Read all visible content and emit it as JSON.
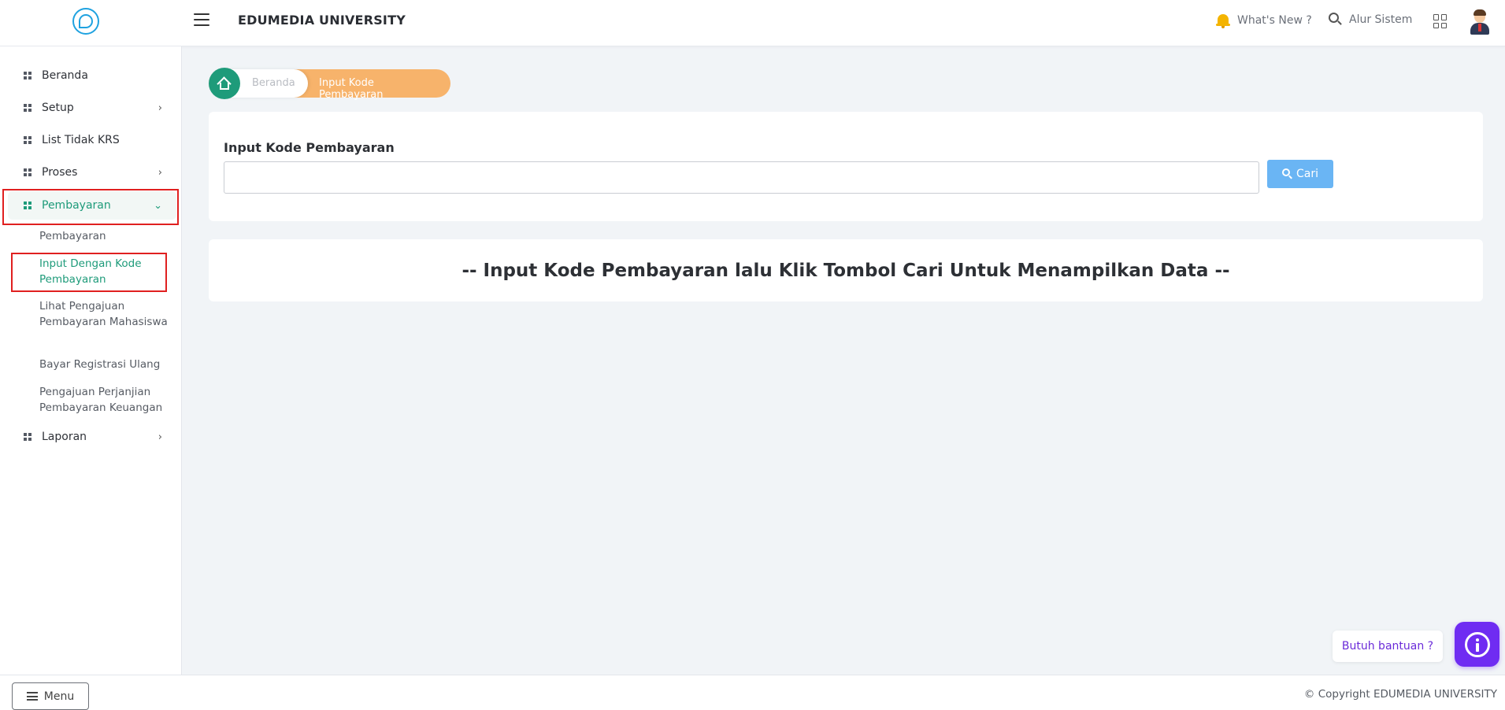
{
  "header": {
    "app_title": "EDUMEDIA UNIVERSITY",
    "whats_new": "What's New ?",
    "alur_sistem": "Alur Sistem"
  },
  "sidebar": {
    "items": [
      {
        "label": "Beranda"
      },
      {
        "label": "Setup"
      },
      {
        "label": "List Tidak KRS"
      },
      {
        "label": "Proses"
      },
      {
        "label": "Pembayaran"
      },
      {
        "label": "Laporan"
      }
    ],
    "pembayaran_sub": [
      {
        "label": "Pembayaran"
      },
      {
        "label": "Input Dengan Kode Pembayaran"
      },
      {
        "label": "Lihat Pengajuan Pembayaran Mahasiswa"
      },
      {
        "label": "Bayar Registrasi Ulang"
      },
      {
        "label": "Pengajuan Perjanjian Pembayaran Keuangan"
      }
    ]
  },
  "breadcrumb": {
    "home": "Beranda",
    "current": "Input Kode Pembayaran"
  },
  "form": {
    "label": "Input Kode Pembayaran",
    "input_value": "",
    "input_placeholder": "",
    "search_button": "Cari"
  },
  "message": "-- Input Kode Pembayaran lalu Klik Tombol Cari Untuk Menampilkan Data --",
  "footer": {
    "menu_button": "Menu",
    "copyright": "© Copyright EDUMEDIA UNIVERSITY"
  },
  "help": {
    "bubble": "Butuh bantuan ?"
  },
  "colors": {
    "primary_green": "#1e9b7a",
    "breadcrumb_orange": "#f7b36b",
    "search_button_blue": "#6ab5f4",
    "help_purple": "#6f2cf2",
    "highlight_red": "#e02020"
  }
}
